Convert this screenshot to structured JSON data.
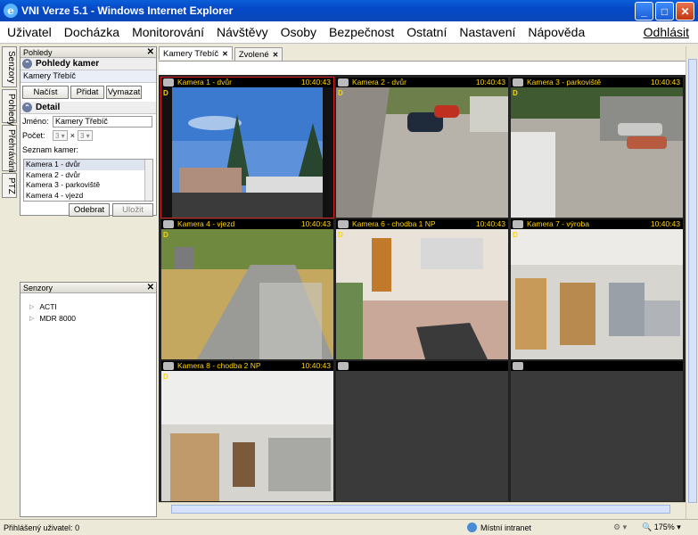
{
  "window": {
    "title": "VNI Verze 5.1 - Windows Internet Explorer",
    "ie_icon": "e"
  },
  "menu": {
    "items": [
      "Uživatel",
      "Docházka",
      "Monitorování",
      "Návštěvy",
      "Osoby",
      "Bezpečnost",
      "Ostatní",
      "Nastavení",
      "Nápověda"
    ],
    "logout": "Odhlásit"
  },
  "vtabs": [
    "Senzory",
    "Pohledy",
    "Přehrávání",
    "PTZ"
  ],
  "pohledy_panel": {
    "header": "Pohledy",
    "section_title": "Pohledy kamer",
    "selected_view": "Kamery Třebíč",
    "buttons": {
      "load": "Načíst",
      "add": "Přidat",
      "delete": "Vymazat"
    }
  },
  "detail": {
    "title": "Detail",
    "name_label": "Jméno:",
    "name_value": "Kamery Třebíč",
    "count_label": "Počet:",
    "count_a": "3",
    "times": "×",
    "count_b": "3",
    "list_label": "Seznam kamer:",
    "list": [
      "Kamera 1 - dvůr",
      "Kamera 2 - dvůr",
      "Kamera 3 - parkoviště",
      "Kamera 4 - vjezd"
    ],
    "remove_button": "Odebrat",
    "save_button": "Uložit"
  },
  "senzory_panel": {
    "header": "Senzory",
    "items": [
      "ACTI",
      "MDR 8000"
    ]
  },
  "doc_tabs": [
    {
      "label": "Kamery Třebíč"
    },
    {
      "label": "Zvolené"
    }
  ],
  "cameras": [
    {
      "name": "Kamera 1 - dvůr",
      "time": "10:40:43",
      "d": "D"
    },
    {
      "name": "Kamera 2 - dvůr",
      "time": "10:40:43",
      "d": "D"
    },
    {
      "name": "Kamera 3 - parkoviště",
      "time": "10:40:43",
      "d": "D"
    },
    {
      "name": "Kamera 4 - vjezd",
      "time": "10:40:43",
      "d": "D"
    },
    {
      "name": "Kamera 6 - chodba 1 NP",
      "time": "10:40:43",
      "d": "D"
    },
    {
      "name": "Kamera 7 - výroba",
      "time": "10:40:43",
      "d": "D"
    },
    {
      "name": "Kamera 8 - chodba 2 NP",
      "time": "10:40:43",
      "d": "D"
    },
    {
      "name": "",
      "time": "",
      "d": ""
    },
    {
      "name": "",
      "time": "",
      "d": ""
    }
  ],
  "status": {
    "user_label": "Přihlášený uživatel:",
    "user_value": "0",
    "zone": "Místní intranet",
    "zoom": "175%"
  }
}
